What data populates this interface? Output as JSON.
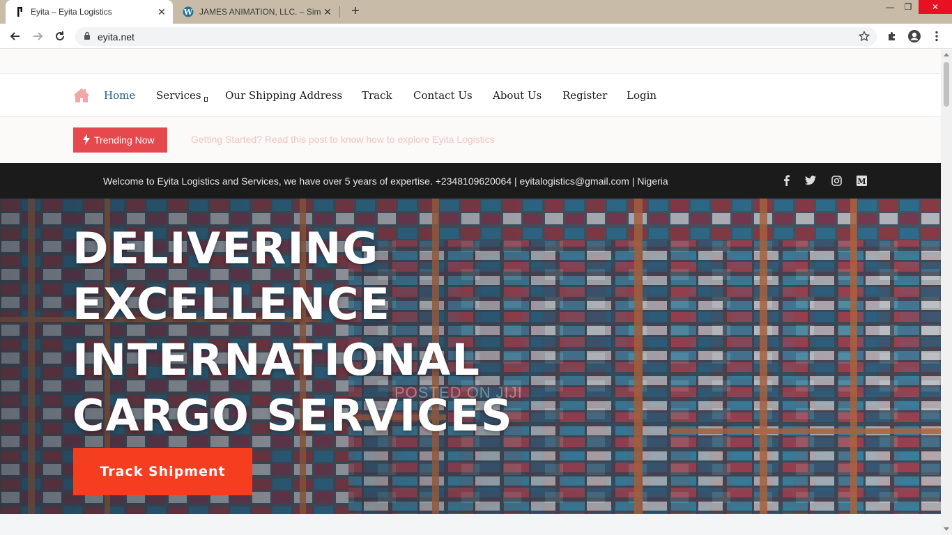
{
  "browser": {
    "tabs": [
      {
        "title": "Eyita – Eyita Logistics",
        "active": true
      },
      {
        "title": "JAMES ANIMATION, LLC. – Simpl",
        "active": false
      }
    ],
    "new_tab": "+",
    "close_glyph": "✕",
    "url": "eyita.net",
    "window_controls": {
      "minimize": "—",
      "restore": "❐",
      "close": "✕"
    }
  },
  "nav": {
    "items": [
      {
        "label": "Home",
        "active": true
      },
      {
        "label": "Services",
        "has_dropdown": true
      },
      {
        "label": "Our Shipping Address"
      },
      {
        "label": "Track"
      },
      {
        "label": "Contact Us"
      },
      {
        "label": "About Us"
      },
      {
        "label": "Register"
      },
      {
        "label": "Login"
      }
    ]
  },
  "trending": {
    "button_label": "Trending Now",
    "headline": "Getting Started? Read this post to know how to explore Eyita Logistics"
  },
  "infobar": {
    "welcome": "Welcome to Eyita Logistics and Services, we have over 5 years of expertise. +2348109620064 | eyitalogistics@gmail.com | Nigeria",
    "social_icons": [
      "facebook-icon",
      "twitter-icon",
      "instagram-icon",
      "medium-icon"
    ]
  },
  "hero": {
    "lines": [
      "DELIVERING",
      "EXCELLENCE",
      "INTERNATIONAL",
      "CARGO SERVICES"
    ],
    "watermark": "POSTED ON JIJI",
    "cta_label": "Track Shipment"
  },
  "colors": {
    "tabbar": "#c8bca8",
    "nav_active": "#1e5c8a",
    "trending_button": "#e5484d",
    "trending_text": "#f3c4c4",
    "infobar": "#1b1b1b",
    "cta": "#f53d20",
    "home_icon": "#f4a6a6"
  }
}
